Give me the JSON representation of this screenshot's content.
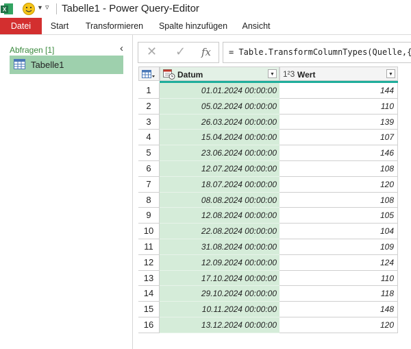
{
  "window": {
    "title": "Tabelle1 - Power Query-Editor",
    "qat_more": "▿"
  },
  "ribbon": {
    "tabs": [
      "Datei",
      "Start",
      "Transformieren",
      "Spalte hinzufügen",
      "Ansicht"
    ]
  },
  "queries": {
    "header": "Abfragen [1]",
    "items": [
      {
        "label": "Tabelle1",
        "selected": true
      }
    ]
  },
  "formula_bar": {
    "formula": "= Table.TransformColumnTypes(Quelle,{"
  },
  "table": {
    "columns": [
      {
        "name": "Datum",
        "type_icon": "date-time-type-icon"
      },
      {
        "name": "Wert",
        "type_icon": "whole-number-type-icon",
        "type_label": "1²3"
      }
    ],
    "rows": [
      {
        "idx": "1",
        "datum": "01.01.2024 00:00:00",
        "wert": "144"
      },
      {
        "idx": "2",
        "datum": "05.02.2024 00:00:00",
        "wert": "110"
      },
      {
        "idx": "3",
        "datum": "26.03.2024 00:00:00",
        "wert": "139"
      },
      {
        "idx": "4",
        "datum": "15.04.2024 00:00:00",
        "wert": "107"
      },
      {
        "idx": "5",
        "datum": "23.06.2024 00:00:00",
        "wert": "146"
      },
      {
        "idx": "6",
        "datum": "12.07.2024 00:00:00",
        "wert": "108"
      },
      {
        "idx": "7",
        "datum": "18.07.2024 00:00:00",
        "wert": "120"
      },
      {
        "idx": "8",
        "datum": "08.08.2024 00:00:00",
        "wert": "108"
      },
      {
        "idx": "9",
        "datum": "12.08.2024 00:00:00",
        "wert": "105"
      },
      {
        "idx": "10",
        "datum": "22.08.2024 00:00:00",
        "wert": "104"
      },
      {
        "idx": "11",
        "datum": "31.08.2024 00:00:00",
        "wert": "109"
      },
      {
        "idx": "12",
        "datum": "12.09.2024 00:00:00",
        "wert": "124"
      },
      {
        "idx": "13",
        "datum": "17.10.2024 00:00:00",
        "wert": "110"
      },
      {
        "idx": "14",
        "datum": "29.10.2024 00:00:00",
        "wert": "118"
      },
      {
        "idx": "15",
        "datum": "10.11.2024 00:00:00",
        "wert": "148"
      },
      {
        "idx": "16",
        "datum": "13.12.2024 00:00:00",
        "wert": "120"
      }
    ]
  },
  "colors": {
    "file_tab": "#d32f2f",
    "selected_query": "#9ed0ad",
    "selected_column": "#d5ecd9",
    "quality_bar": "#1fae9b",
    "excel_green": "#1e7145"
  }
}
